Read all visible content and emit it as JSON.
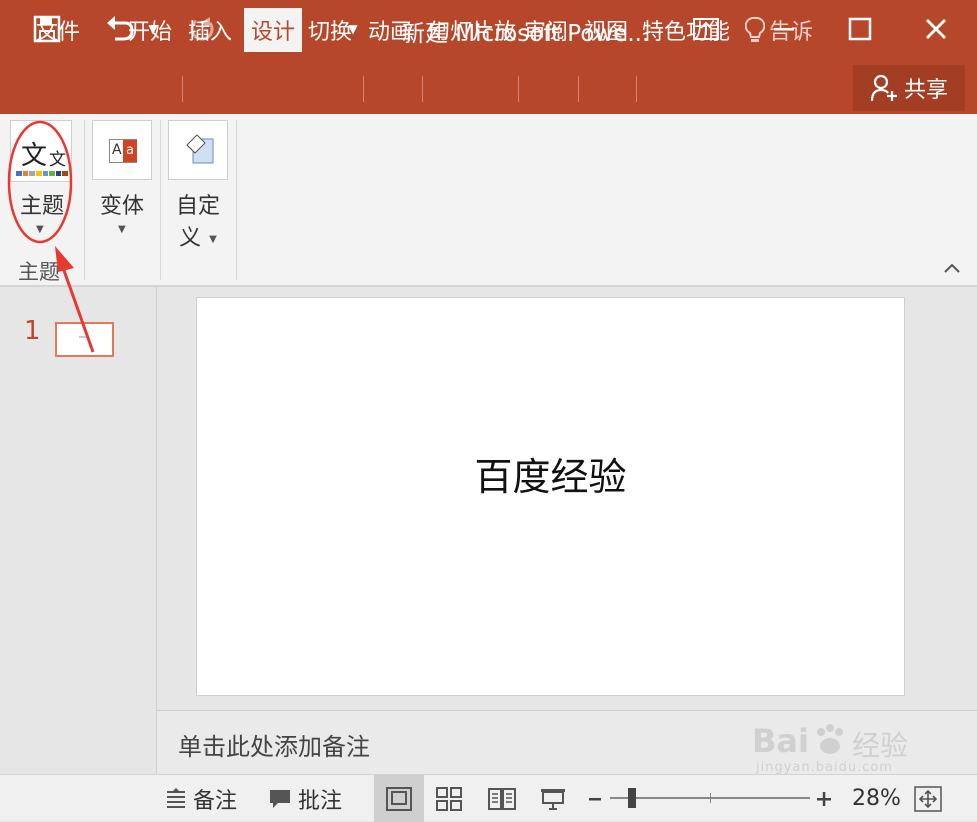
{
  "window": {
    "title": "新建 Microsoft Powe..."
  },
  "tabs": [
    {
      "label": "文件"
    },
    {
      "label": "开始"
    },
    {
      "label": "插入"
    },
    {
      "label": "设计"
    },
    {
      "label": "切换"
    },
    {
      "label": "动画"
    },
    {
      "label": "幻灯片放"
    },
    {
      "label": "审阅"
    },
    {
      "label": "视图"
    },
    {
      "label": "特色功能"
    }
  ],
  "tell_me": "告诉",
  "share": "共享",
  "ribbon": {
    "themes_label": "主题",
    "themes_group_label": "主题",
    "variants_label": "变体",
    "customize_label_1": "自定",
    "customize_label_2": "义",
    "theme_sample_big": "文",
    "theme_sample_small": "文",
    "variant_sample": "Aa"
  },
  "slides": {
    "number": "1"
  },
  "slide": {
    "text": "百度经验"
  },
  "notes": {
    "placeholder": "单击此处添加备注"
  },
  "status": {
    "notes": "备注",
    "comments": "批注",
    "zoom": "28%"
  },
  "watermark": {
    "brand": "Bai",
    "brand2": "经验",
    "url": "jingyan.baidu.com"
  },
  "colors": {
    "accent": "#b7472a",
    "annotation": "#e8392f"
  }
}
